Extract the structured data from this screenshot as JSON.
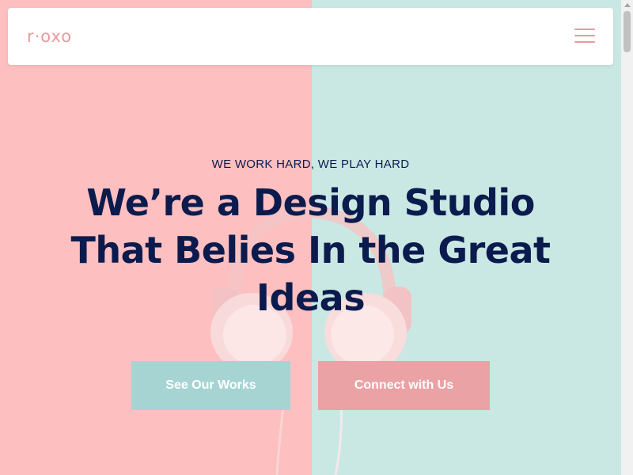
{
  "brand": {
    "logo_text": "r·oxo"
  },
  "nav": {
    "menu_icon": "hamburger-menu-icon"
  },
  "hero": {
    "eyebrow": "WE WORK HARD, WE PLAY HARD",
    "headline": "We’re a Design Studio That Belies In the Great Ideas",
    "buttons": {
      "primary_label": "See Our Works",
      "secondary_label": "Connect with Us"
    }
  },
  "colors": {
    "pink_bg": "#fdbfc0",
    "mint_bg": "#c9e8e3",
    "navy_text": "#0c1b4d",
    "accent_pink": "#e89a9c",
    "button_mint": "#a6d4d2",
    "button_pink": "#eaa2a5"
  }
}
